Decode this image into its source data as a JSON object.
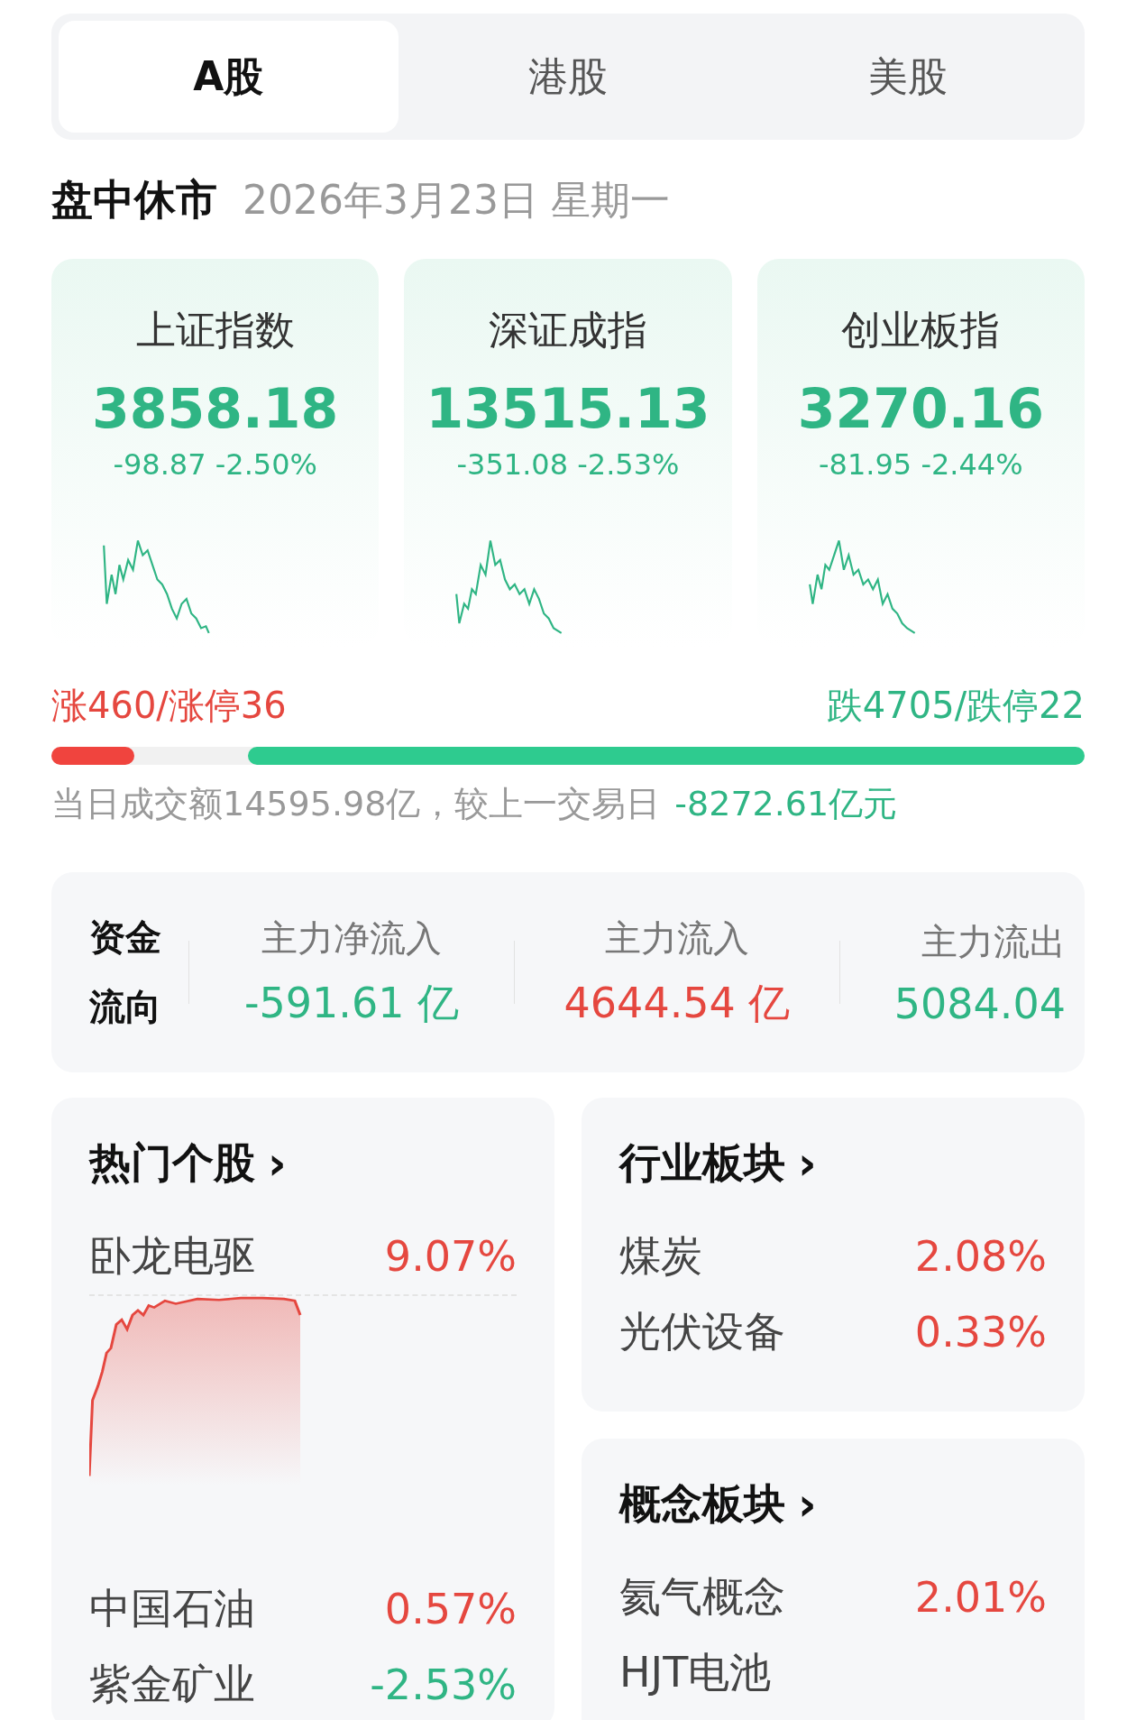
{
  "tabs": [
    {
      "label": "A股",
      "selected": true
    },
    {
      "label": "港股",
      "selected": false
    },
    {
      "label": "美股",
      "selected": false
    }
  ],
  "session": {
    "status": "盘中休市",
    "date": "2026年3月23日 星期一"
  },
  "indices": [
    {
      "name": "上证指数",
      "value": "3858.18",
      "change": "-98.87 -2.50%",
      "color": "#2fb584"
    },
    {
      "name": "深证成指",
      "value": "13515.13",
      "change": "-351.08 -2.53%",
      "color": "#2fb584"
    },
    {
      "name": "创业板指",
      "value": "3270.16",
      "change": "-81.95 -2.44%",
      "color": "#2fb584"
    }
  ],
  "breadth": {
    "up": {
      "label": "涨460/涨停36",
      "level": 0.08
    },
    "down": {
      "label": "跌4705/跌停22",
      "level": 0.81
    }
  },
  "turnover": {
    "text": "当日成交额14595.98亿，较上一交易日",
    "delta": "-8272.61亿元",
    "color": "#2fb584"
  },
  "fund_flow": {
    "title_lines": [
      "资金",
      "流向"
    ],
    "items": [
      {
        "label": "主力净流入",
        "value": "-591.61 亿",
        "color": "#2fb584"
      },
      {
        "label": "主力流入",
        "value": "4644.54 亿",
        "color": "#e5473f"
      },
      {
        "label": "主力流出",
        "value": "5084.04",
        "color": "#2fb584"
      }
    ]
  },
  "hot_stocks": {
    "title": "热门个股",
    "chevron": "›",
    "rows": [
      {
        "name": "卧龙电驱",
        "value": "9.07%",
        "color": "#e5473f",
        "kind": "chart"
      },
      {
        "name": "中国石油",
        "value": "0.57%",
        "color": "#e5473f",
        "kind": "plain"
      },
      {
        "name": "紫金矿业",
        "value": "-2.53%",
        "color": "#2fb584",
        "kind": "plain"
      }
    ]
  },
  "industry": {
    "title": "行业板块",
    "chevron": "›",
    "rows": [
      {
        "name": "煤炭",
        "value": "2.08%",
        "color": "#e5473f"
      },
      {
        "name": "光伏设备",
        "value": "0.33%",
        "color": "#e5473f"
      }
    ]
  },
  "concept": {
    "title": "概念板块",
    "chevron": "›",
    "rows": [
      {
        "name": "氦气概念",
        "value": "2.01%",
        "color": "#e5473f"
      },
      {
        "name": "HJT电池"
      }
    ]
  }
}
